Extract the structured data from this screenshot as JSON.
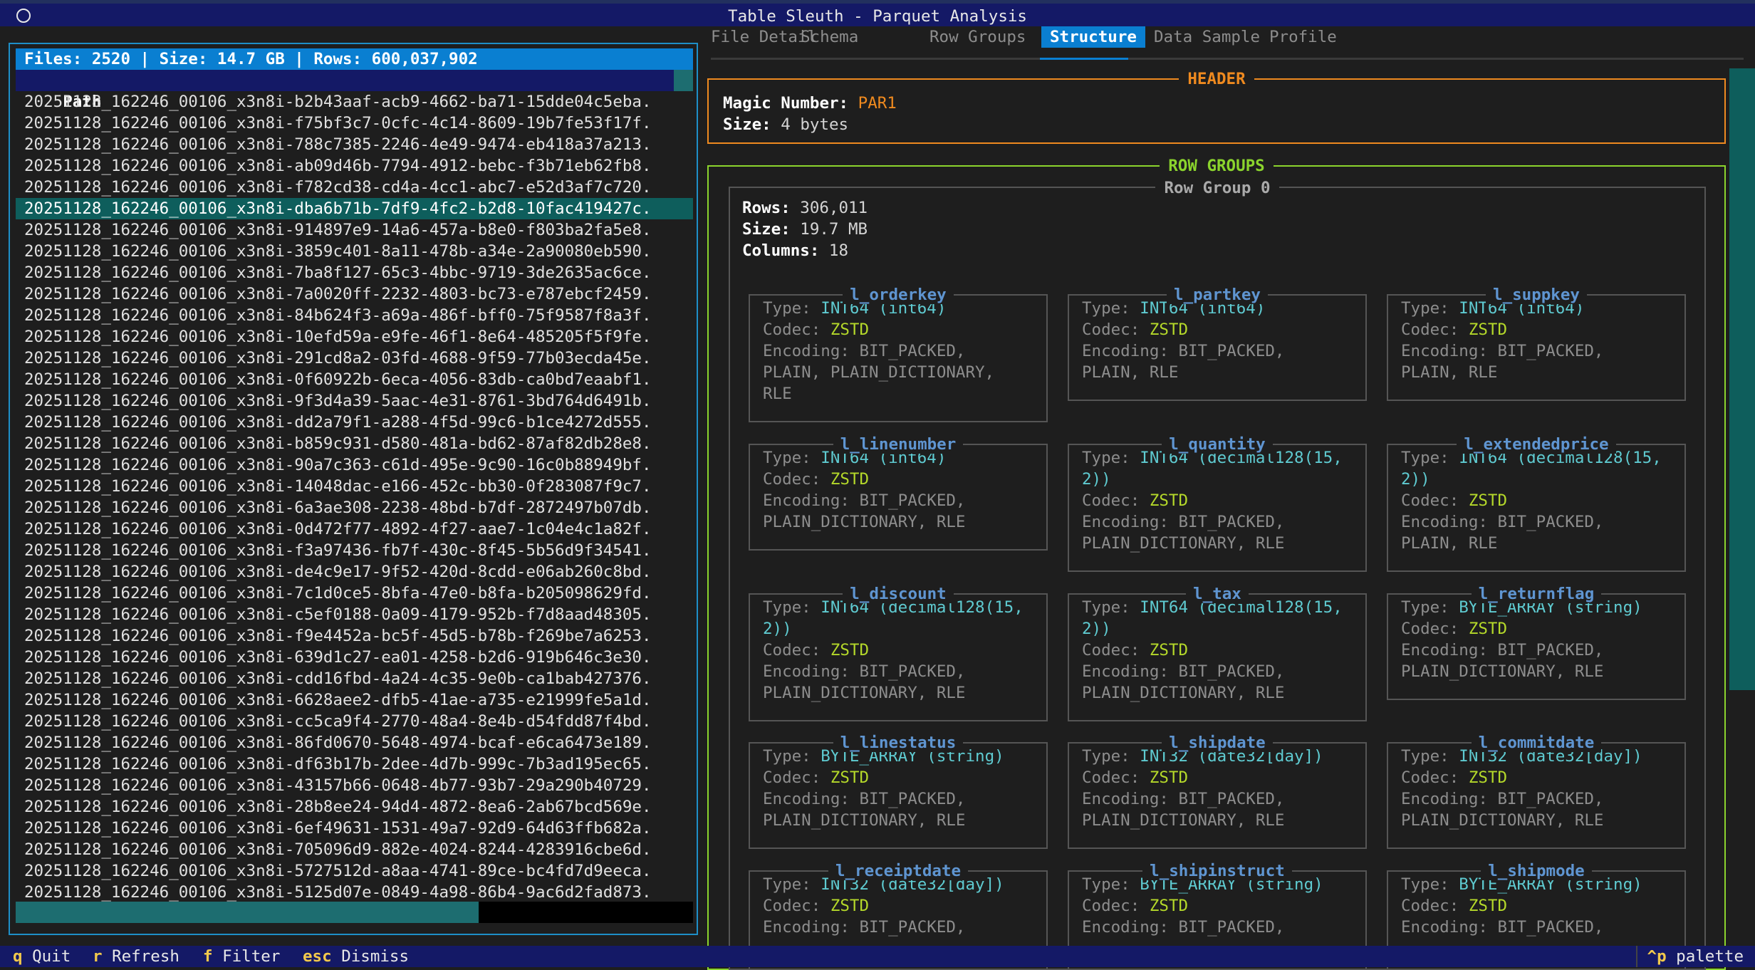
{
  "window": {
    "title": "Table Sleuth - Parquet Analysis"
  },
  "files": {
    "summary": "Files: 2520 | Size: 14.7 GB | Rows: 600,037,902",
    "column_header": "Path",
    "rows": [
      "20251128_162246_00106_x3n8i-b2b43aaf-acb9-4662-ba71-15dde04c5eba.",
      "20251128_162246_00106_x3n8i-f75bf3c7-0cfc-4c14-8609-19b7fe53f17f.",
      "20251128_162246_00106_x3n8i-788c7385-2246-4e49-9474-eb418a37a213.",
      "20251128_162246_00106_x3n8i-ab09d46b-7794-4912-bebc-f3b71eb62fb8.",
      "20251128_162246_00106_x3n8i-f782cd38-cd4a-4cc1-abc7-e52d3af7c720.",
      "20251128_162246_00106_x3n8i-dba6b71b-7df9-4fc2-b2d8-10fac419427c.",
      "20251128_162246_00106_x3n8i-914897e9-14a6-457a-b8e0-f803ba2fa5e8.",
      "20251128_162246_00106_x3n8i-3859c401-8a11-478b-a34e-2a90080eb590.",
      "20251128_162246_00106_x3n8i-7ba8f127-65c3-4bbc-9719-3de2635ac6ce.",
      "20251128_162246_00106_x3n8i-7a0020ff-2232-4803-bc73-e787ebcf2459.",
      "20251128_162246_00106_x3n8i-84b624f3-a69a-486f-bff0-75f9587f8a3f.",
      "20251128_162246_00106_x3n8i-10efd59a-e9fe-46f1-8e64-485205f5f9fe.",
      "20251128_162246_00106_x3n8i-291cd8a2-03fd-4688-9f59-77b03ecda45e.",
      "20251128_162246_00106_x3n8i-0f60922b-6eca-4056-83db-ca0bd7eaabf1.",
      "20251128_162246_00106_x3n8i-9f3d4a39-5aac-4e31-8761-3bd764d6491b.",
      "20251128_162246_00106_x3n8i-dd2a79f1-a288-4f5d-99c6-b1ce4272d555.",
      "20251128_162246_00106_x3n8i-b859c931-d580-481a-bd62-87af82db28e8.",
      "20251128_162246_00106_x3n8i-90a7c363-c61d-495e-9c90-16c0b88949bf.",
      "20251128_162246_00106_x3n8i-14048dac-e166-452c-bb30-0f283087f9c7.",
      "20251128_162246_00106_x3n8i-6a3ae308-2238-48bd-b7df-2872497b07db.",
      "20251128_162246_00106_x3n8i-0d472f77-4892-4f27-aae7-1c04e4c1a82f.",
      "20251128_162246_00106_x3n8i-f3a97436-fb7f-430c-8f45-5b56d9f34541.",
      "20251128_162246_00106_x3n8i-de4c9e17-9f52-420d-8cdd-e06ab260c8bd.",
      "20251128_162246_00106_x3n8i-7c1d0ce5-8bfa-47e0-b8fa-b205098629fd.",
      "20251128_162246_00106_x3n8i-c5ef0188-0a09-4179-952b-f7d8aad48305.",
      "20251128_162246_00106_x3n8i-f9e4452a-bc5f-45d5-b78b-f269be7a6253.",
      "20251128_162246_00106_x3n8i-639d1c27-ea01-4258-b2d6-919b646c3e30.",
      "20251128_162246_00106_x3n8i-cdd16fbd-4a24-4c35-9e0b-ca1bab427376.",
      "20251128_162246_00106_x3n8i-6628aee2-dfb5-41ae-a735-e21999fe5a1d.",
      "20251128_162246_00106_x3n8i-cc5ca9f4-2770-48a4-8e4b-d54fdd87f4bd.",
      "20251128_162246_00106_x3n8i-86fd0670-5648-4974-bcaf-e6ca6473e189.",
      "20251128_162246_00106_x3n8i-df63b17b-2dee-4d7b-999c-7b3ad195ec65.",
      "20251128_162246_00106_x3n8i-43157b66-0648-4b77-93b7-29a290b40729.",
      "20251128_162246_00106_x3n8i-28b8ee24-94d4-4872-8ea6-2ab67bcd569e.",
      "20251128_162246_00106_x3n8i-6ef49631-1531-49a7-92d9-64d63ffb682a.",
      "20251128_162246_00106_x3n8i-705096d9-882e-4024-8244-4283916cbe6d.",
      "20251128_162246_00106_x3n8i-5727512d-a8aa-4741-89ce-bc4fd7d9eeca.",
      "20251128_162246_00106_x3n8i-5125d07e-0849-4a98-86b4-9ac6d2fad873."
    ],
    "selected_index": 5
  },
  "tabs": [
    {
      "label": "File Detail",
      "active": false
    },
    {
      "label": "Schema",
      "active": false
    },
    {
      "label": "Row Groups",
      "active": false
    },
    {
      "label": "Structure",
      "active": true
    },
    {
      "label": "Data Sample",
      "active": false
    },
    {
      "label": "Profile",
      "active": false
    }
  ],
  "header": {
    "title": "HEADER",
    "magic_label": "Magic Number:",
    "magic_value": "PAR1",
    "size_label": "Size:",
    "size_value": "4 bytes"
  },
  "row_groups": {
    "title": "ROW GROUPS",
    "group": {
      "title": "Row Group 0",
      "rows_label": "Rows:",
      "rows_value": "306,011",
      "size_label": "Size:",
      "size_value": "19.7 MB",
      "columns_label": "Columns:",
      "columns_value": "18"
    },
    "field_labels": {
      "type": "Type:",
      "codec": "Codec:",
      "encoding": "Encoding:"
    },
    "columns": [
      {
        "name": "l_orderkey",
        "type": "INT64 (int64)",
        "codec": "ZSTD",
        "encoding": "BIT_PACKED,\nPLAIN, PLAIN_DICTIONARY,\nRLE"
      },
      {
        "name": "l_partkey",
        "type": "INT64 (int64)",
        "codec": "ZSTD",
        "encoding": "BIT_PACKED,\nPLAIN, RLE"
      },
      {
        "name": "l_suppkey",
        "type": "INT64 (int64)",
        "codec": "ZSTD",
        "encoding": "BIT_PACKED,\nPLAIN, RLE"
      },
      {
        "name": "l_linenumber",
        "type": "INT64 (int64)",
        "codec": "ZSTD",
        "encoding": "BIT_PACKED,\nPLAIN_DICTIONARY, RLE"
      },
      {
        "name": "l_quantity",
        "type": "INT64 (decimal128(15,\n2))",
        "codec": "ZSTD",
        "encoding": "BIT_PACKED,\nPLAIN_DICTIONARY, RLE"
      },
      {
        "name": "l_extendedprice",
        "type": "INT64 (decimal128(15,\n2))",
        "codec": "ZSTD",
        "encoding": "BIT_PACKED,\nPLAIN, RLE"
      },
      {
        "name": "l_discount",
        "type": "INT64 (decimal128(15,\n2))",
        "codec": "ZSTD",
        "encoding": "BIT_PACKED,\nPLAIN_DICTIONARY, RLE"
      },
      {
        "name": "l_tax",
        "type": "INT64 (decimal128(15,\n2))",
        "codec": "ZSTD",
        "encoding": "BIT_PACKED,\nPLAIN_DICTIONARY, RLE"
      },
      {
        "name": "l_returnflag",
        "type": "BYTE_ARRAY (string)",
        "codec": "ZSTD",
        "encoding": "BIT_PACKED,\nPLAIN_DICTIONARY, RLE"
      },
      {
        "name": "l_linestatus",
        "type": "BYTE_ARRAY (string)",
        "codec": "ZSTD",
        "encoding": "BIT_PACKED,\nPLAIN_DICTIONARY, RLE"
      },
      {
        "name": "l_shipdate",
        "type": "INT32 (date32[day])",
        "codec": "ZSTD",
        "encoding": "BIT_PACKED,\nPLAIN_DICTIONARY, RLE"
      },
      {
        "name": "l_commitdate",
        "type": "INT32 (date32[day])",
        "codec": "ZSTD",
        "encoding": "BIT_PACKED,\nPLAIN_DICTIONARY, RLE"
      },
      {
        "name": "l_receiptdate",
        "type": "INT32 (date32[day])",
        "codec": "ZSTD",
        "encoding": "BIT_PACKED,"
      },
      {
        "name": "l_shipinstruct",
        "type": "BYTE_ARRAY (string)",
        "codec": "ZSTD",
        "encoding": "BIT_PACKED,"
      },
      {
        "name": "l_shipmode",
        "type": "BYTE_ARRAY (string)",
        "codec": "ZSTD",
        "encoding": "BIT_PACKED,"
      }
    ]
  },
  "footer": {
    "shortcuts": [
      {
        "key": "q",
        "label": "Quit"
      },
      {
        "key": "r",
        "label": "Refresh"
      },
      {
        "key": "f",
        "label": "Filter"
      },
      {
        "key": "esc",
        "label": "Dismiss"
      }
    ],
    "palette_key": "^p",
    "palette_label": "palette"
  },
  "colors": {
    "title_bar": "#141966",
    "accent_blue": "#0a7fd1",
    "selection": "#0e5e5c",
    "header_border": "#ef8a1f",
    "row_groups_border": "#8bd42d",
    "column_name": "#5f95d1",
    "type_value": "#5fcbd1",
    "codec_value": "#b5d92a",
    "shortcut_key": "#f2c94c"
  }
}
